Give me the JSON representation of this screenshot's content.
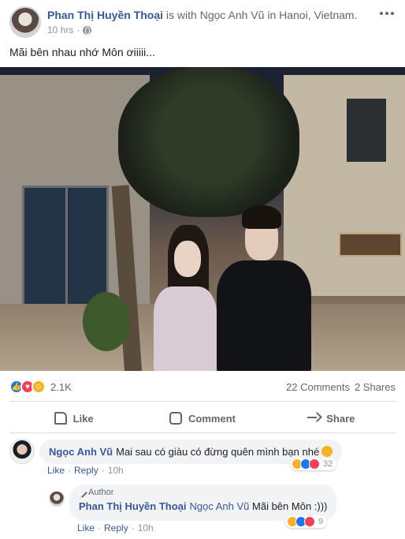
{
  "post": {
    "author_name": "Phan Thị Huyền Thoại",
    "with_text": " is with ",
    "tagged_name": "Ngọc Anh Vũ",
    "in_text": " in ",
    "location": "Hanoi, Vietnam",
    "period": ".",
    "time": "10 hrs",
    "time_sep": "·",
    "text": "Mãi bên nhau nhớ Môn ơiiiii..."
  },
  "stats": {
    "reaction_count": "2.1K",
    "comments": "22 Comments",
    "shares": "2 Shares"
  },
  "actions": {
    "like": "Like",
    "comment": "Comment",
    "share": "Share"
  },
  "comments": [
    {
      "name": "Ngọc Anh Vũ",
      "text": "Mai sau có giàu có đừng quên mình bạn nhé",
      "like": "Like",
      "reply": "Reply",
      "time": "10h",
      "reactions": "32"
    },
    {
      "author_tag": "Author",
      "name": "Phan Thị Huyền Thoại",
      "mention": "Ngọc Anh Vũ",
      "text": " Mãi bên Môn :)))",
      "like": "Like",
      "reply": "Reply",
      "time": "10h",
      "reactions": "9"
    }
  ],
  "colors": {
    "link_blue": "#365899",
    "like_blue": "#1877f2",
    "love_red": "#f33e58",
    "haha_yellow": "#f7b125"
  }
}
